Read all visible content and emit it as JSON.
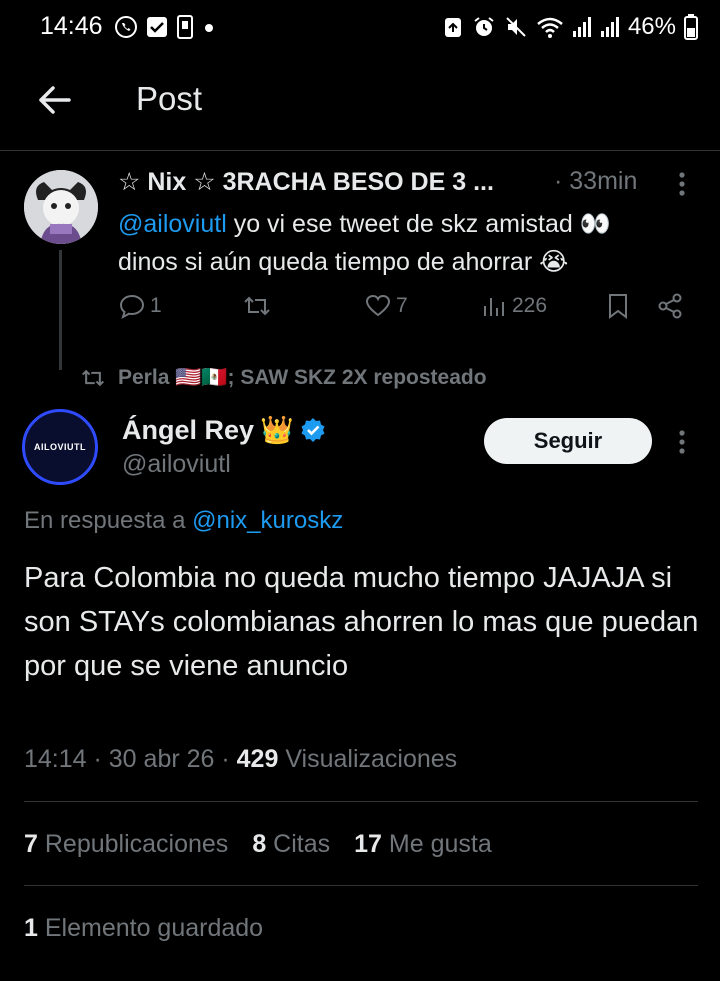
{
  "status_bar": {
    "time": "14:46",
    "battery": "46%",
    "icons_left": [
      "whatsapp-icon",
      "checkbox-icon",
      "phone-icon",
      "dot-icon"
    ],
    "icons_right": [
      "recycle-icon",
      "alarm-icon",
      "mute-icon",
      "wifi-icon",
      "signal-icon",
      "signal-icon",
      "battery-icon"
    ]
  },
  "header": {
    "title": "Post"
  },
  "reply_tweet": {
    "display_name": "☆ Nix ☆ 3RACHA BESO DE 3 ...",
    "time": "· 33min",
    "mention": "@ailoviutl",
    "text_line1": " yo vi ese tweet de skz amistad 👀",
    "text_line2": "dinos si aún queda tiempo de ahorrar 😭",
    "replies": "1",
    "retweets": "",
    "likes": "7",
    "views": "226"
  },
  "repost": {
    "label": "Perla 🇺🇸🇲🇽; SAW SKZ 2X reposteado"
  },
  "main_tweet": {
    "display_name": "Ángel Rey",
    "crown": "👑",
    "handle": "@ailoviutl",
    "avatar_text": "AILOVIUTL",
    "follow_label": "Seguir",
    "reply_prefix": "En respuesta a ",
    "reply_to": "@nix_kuroskz",
    "text": "Para Colombia no queda mucho tiempo JAJAJA si son STAYs colombianas ahorren lo mas que puedan por que se viene anuncio",
    "time": "14:14",
    "date": "30 abr 26",
    "views_count": "429",
    "views_label": "Visualizaciones",
    "reposts_count": "7",
    "reposts_label": "Republicaciones",
    "quotes_count": "8",
    "quotes_label": "Citas",
    "likes_count": "17",
    "likes_label": "Me gusta",
    "saved_count": "1",
    "saved_label": "Elemento guardado"
  },
  "colors": {
    "background": "#000000",
    "accent": "#1d9bf0",
    "muted": "#71767b",
    "text": "#e7e9ea"
  }
}
